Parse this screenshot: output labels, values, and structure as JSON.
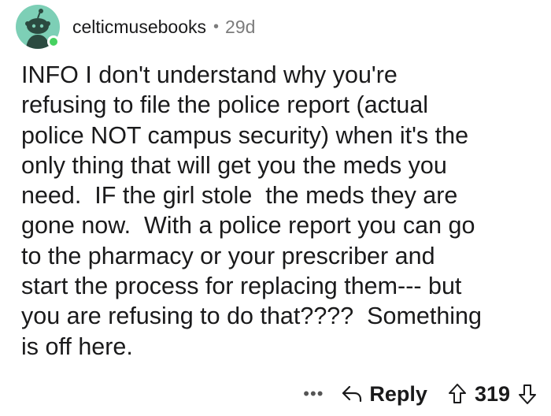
{
  "comment": {
    "author": "celticmusebooks",
    "separator": "•",
    "age": "29d",
    "text": "INFO I don't understand why you're\nrefusing to file the police report (actual\npolice NOT campus security) when it's the\nonly thing that will get you the meds you\nneed.  IF the girl stole  the meds they are\ngone now.  With a police report you can go\nto the pharmacy or your prescriber and\nstart the process for replacing them--- but\nyou are refusing to do that????  Something\nis off here."
  },
  "actions": {
    "more_label": "•••",
    "reply_label": "Reply",
    "score": "319"
  },
  "icons": {
    "avatar": "snoo-avatar-icon",
    "online": "online-status-icon",
    "reply": "reply-arrow-icon",
    "upvote": "upvote-arrow-icon",
    "downvote": "downvote-arrow-icon"
  },
  "colors": {
    "avatar_bg": "#7dcfb6",
    "online": "#46d160",
    "text": "#1a1a1b",
    "meta": "#7c7c7c"
  }
}
